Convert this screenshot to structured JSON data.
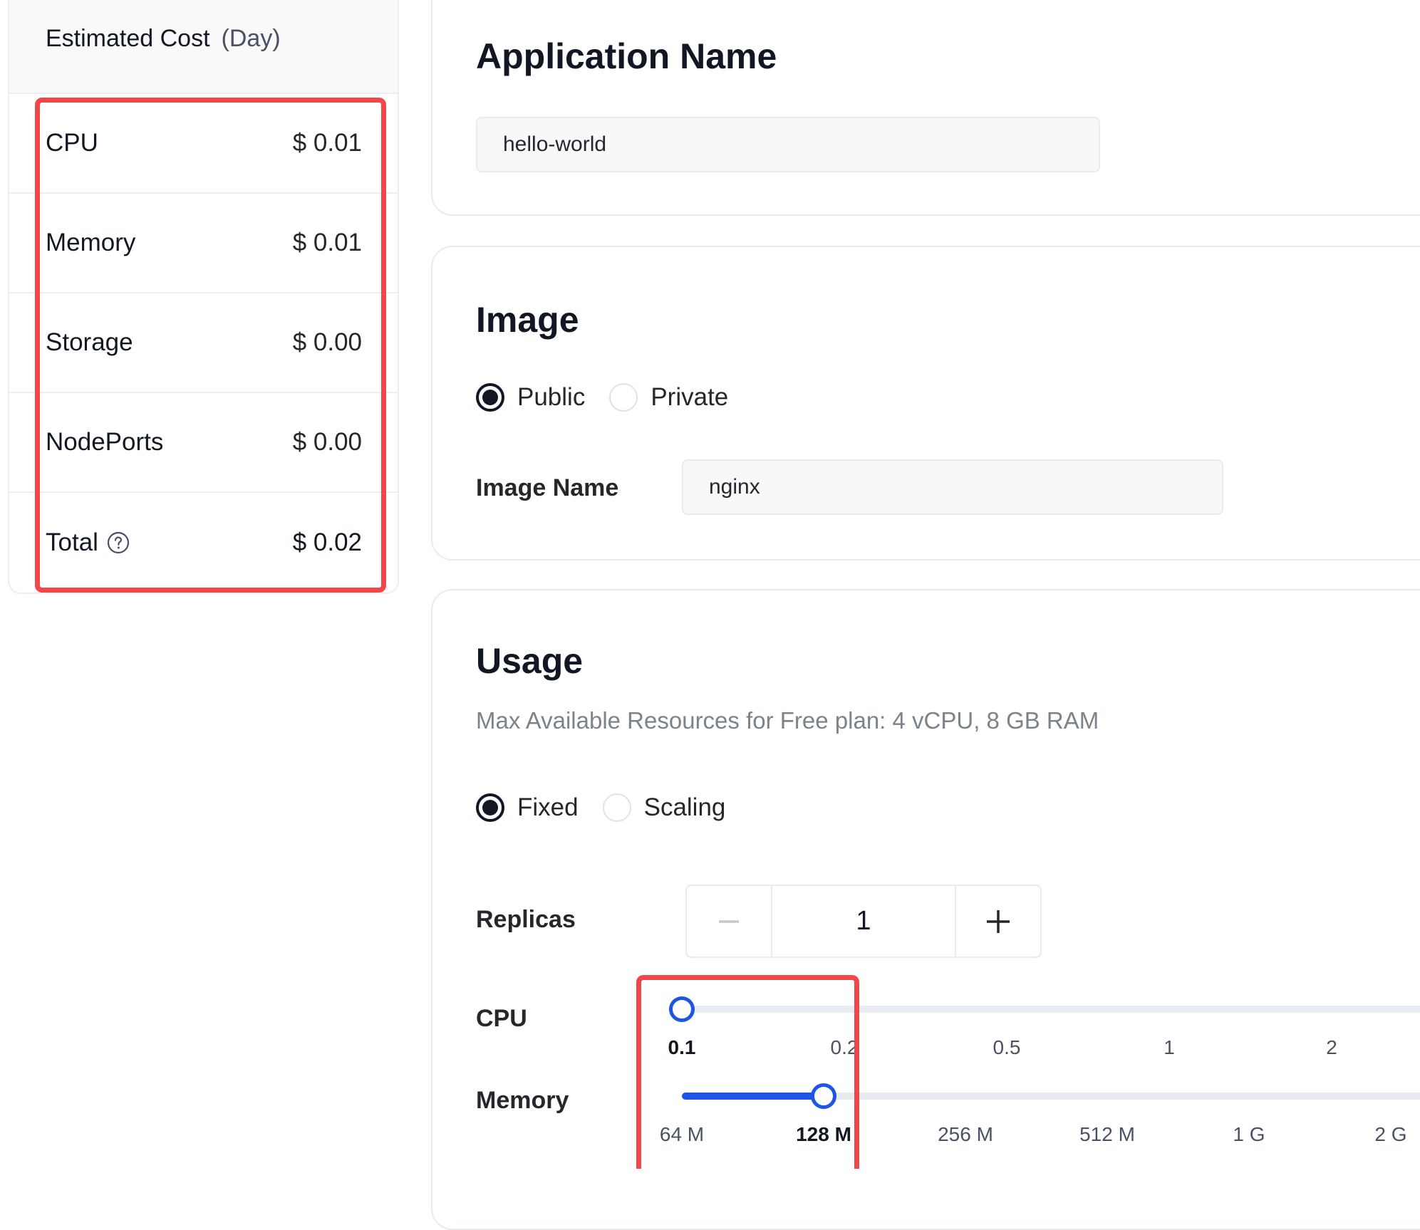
{
  "cost": {
    "title": "Estimated Cost",
    "period": "(Day)",
    "rows": [
      {
        "label": "CPU",
        "value": "$ 0.01"
      },
      {
        "label": "Memory",
        "value": "$ 0.01"
      },
      {
        "label": "Storage",
        "value": "$ 0.00"
      },
      {
        "label": "NodePorts",
        "value": "$ 0.00"
      },
      {
        "label": "Total",
        "value": "$ 0.02"
      }
    ]
  },
  "app_name": {
    "title": "Application Name",
    "value": "hello-world"
  },
  "image": {
    "title": "Image",
    "options": [
      "Public",
      "Private"
    ],
    "selected": "Public",
    "name_label": "Image Name",
    "name_value": "nginx"
  },
  "usage": {
    "title": "Usage",
    "subtitle": "Max Available Resources for Free plan: 4 vCPU, 8 GB RAM",
    "options": [
      "Fixed",
      "Scaling"
    ],
    "selected": "Fixed",
    "replicas_label": "Replicas",
    "replicas_value": "1",
    "cpu": {
      "label": "CPU",
      "ticks": [
        "0.1",
        "0.2",
        "0.5",
        "1",
        "2"
      ],
      "selected": "0.1",
      "selected_index": 0
    },
    "memory": {
      "label": "Memory",
      "ticks": [
        "64 M",
        "128 M",
        "256 M",
        "512 M",
        "1 G",
        "2 G"
      ],
      "selected": "128 M",
      "selected_index": 1
    }
  },
  "colors": {
    "accent": "#1f55e6",
    "highlight": "#f0484a"
  },
  "icons": {
    "help": "question-circle-icon",
    "minus": "minus-icon",
    "plus": "plus-icon"
  }
}
